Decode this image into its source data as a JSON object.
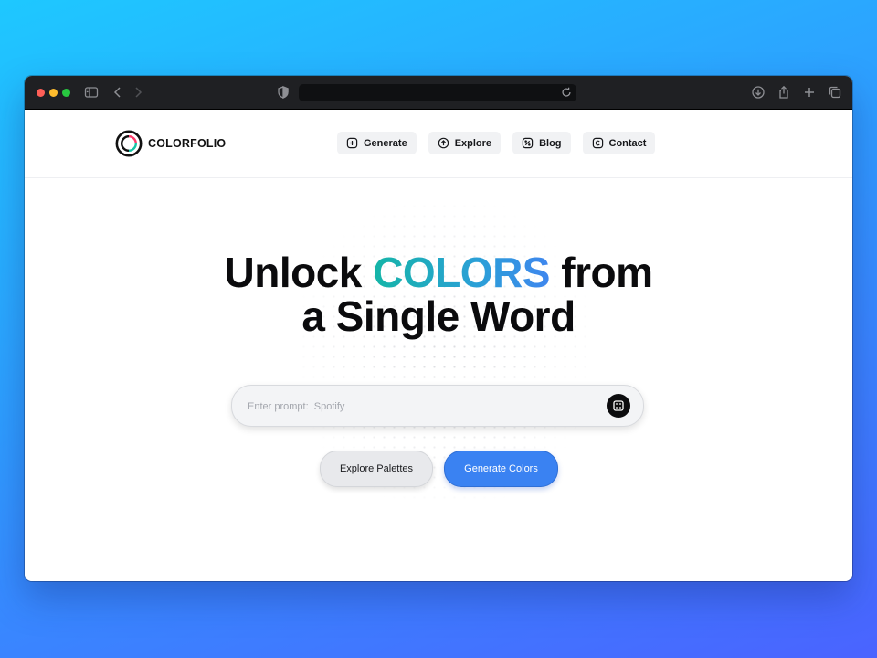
{
  "browser": {
    "url": "",
    "icons": [
      "sidebar-icon",
      "back-icon",
      "forward-icon",
      "shield-icon",
      "reload-icon",
      "download-icon",
      "share-icon",
      "new-tab-icon",
      "tabs-overview-icon"
    ]
  },
  "brand": {
    "name": "COLORFOLIO",
    "logo_colors": [
      "#ff3b6b",
      "#16c3a5",
      "#111111"
    ]
  },
  "nav": {
    "items": [
      {
        "label": "Generate",
        "icon": "plus-square-icon"
      },
      {
        "label": "Explore",
        "icon": "arrow-up-circle-icon"
      },
      {
        "label": "Blog",
        "icon": "percent-square-icon"
      },
      {
        "label": "Contact",
        "icon": "copyright-square-icon"
      }
    ]
  },
  "hero": {
    "line1_pre": "Unlock ",
    "line1_accent": "COLORS",
    "line1_post": " from",
    "line2": "a Single Word",
    "accent_gradient": [
      "#15b5a7",
      "#3f86ee"
    ]
  },
  "prompt": {
    "placeholder": "Enter prompt:  Spotify",
    "value": "",
    "icon": "dice-icon"
  },
  "actions": {
    "explore_label": "Explore Palettes",
    "generate_label": "Generate Colors",
    "generate_color": "#3a82f2"
  }
}
